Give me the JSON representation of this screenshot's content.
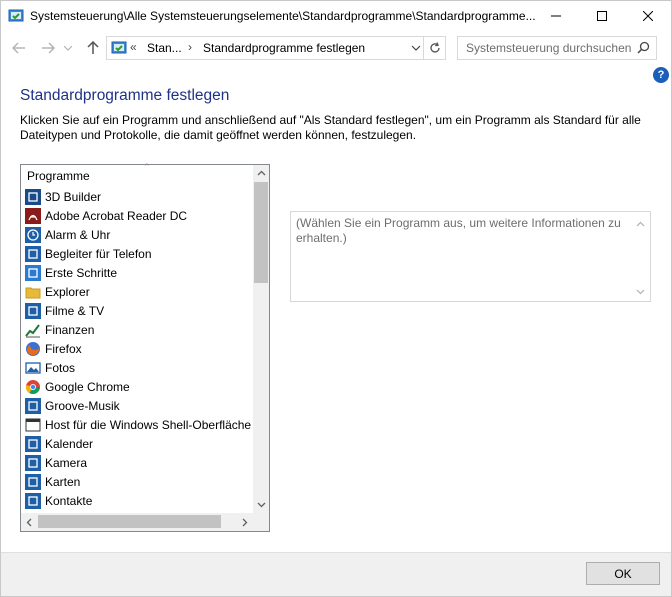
{
  "window": {
    "title": "Systemsteuerung\\Alle Systemsteuerungselemente\\Standardprogramme\\Standardprogramme..."
  },
  "address": {
    "overflow": "«",
    "crumbs": [
      "Stan...",
      "Standardprogramme festlegen"
    ]
  },
  "search": {
    "placeholder": "Systemsteuerung durchsuchen"
  },
  "help": {
    "label": "?"
  },
  "page": {
    "title": "Standardprogramme festlegen",
    "description": "Klicken Sie auf ein Programm und anschließend auf \"Als Standard festlegen\", um ein Programm als Standard für alle Dateitypen und Protokolle, die damit geöffnet werden können, festzulegen."
  },
  "programs": {
    "header": "Programme",
    "items": [
      {
        "label": "3D Builder",
        "icon": "3d-builder-icon",
        "color": "#1a4a8a"
      },
      {
        "label": "Adobe Acrobat Reader DC",
        "icon": "acrobat-icon",
        "color": "#8b1a1a"
      },
      {
        "label": "Alarm & Uhr",
        "icon": "alarm-clock-icon",
        "color": "#1e5fa8"
      },
      {
        "label": "Begleiter für Telefon",
        "icon": "phone-companion-icon",
        "color": "#1e5fa8"
      },
      {
        "label": "Erste Schritte",
        "icon": "get-started-icon",
        "color": "#2a7ad2"
      },
      {
        "label": "Explorer",
        "icon": "folder-icon",
        "color": "#e8b93a"
      },
      {
        "label": "Filme & TV",
        "icon": "film-icon",
        "color": "#1e5fa8"
      },
      {
        "label": "Finanzen",
        "icon": "finance-chart-icon",
        "color": "#1e7a3a"
      },
      {
        "label": "Firefox",
        "icon": "firefox-icon",
        "color": "#e86a1a"
      },
      {
        "label": "Fotos",
        "icon": "photos-icon",
        "color": "#1e5fa8"
      },
      {
        "label": "Google Chrome",
        "icon": "chrome-icon",
        "color": "#db4437"
      },
      {
        "label": "Groove-Musik",
        "icon": "groove-music-icon",
        "color": "#1e5fa8"
      },
      {
        "label": "Host für die Windows Shell-Oberfläche",
        "icon": "shell-host-icon",
        "color": "#333333"
      },
      {
        "label": "Kalender",
        "icon": "calendar-icon",
        "color": "#1e5fa8"
      },
      {
        "label": "Kamera",
        "icon": "camera-icon",
        "color": "#1e5fa8"
      },
      {
        "label": "Karten",
        "icon": "maps-icon",
        "color": "#1e5fa8"
      },
      {
        "label": "Kontakte",
        "icon": "contacts-icon",
        "color": "#1e5fa8"
      }
    ]
  },
  "info": {
    "text": "(Wählen Sie ein Programm aus, um weitere Informationen zu erhalten.)"
  },
  "footer": {
    "ok_label": "OK"
  }
}
